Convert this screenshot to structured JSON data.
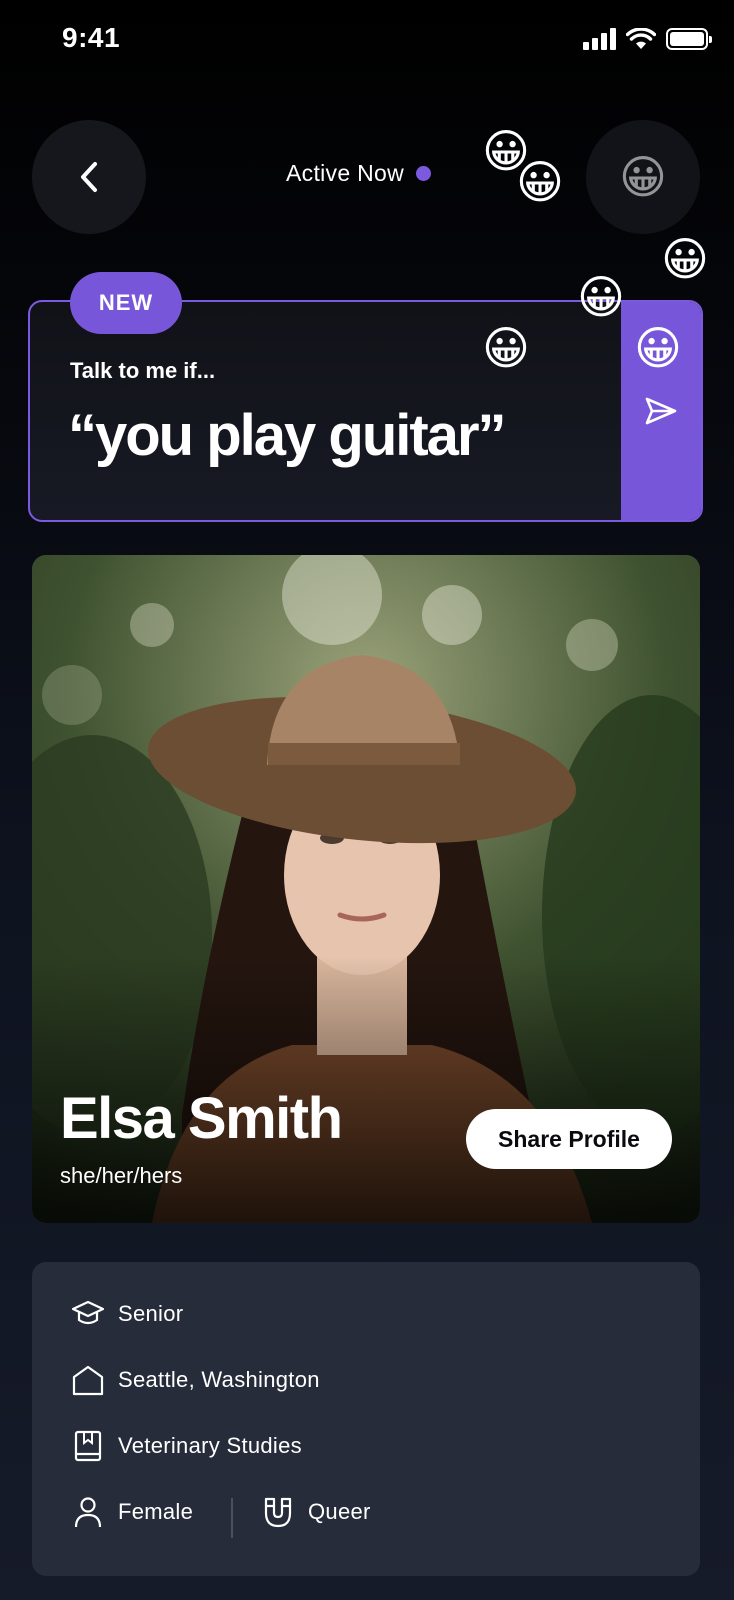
{
  "status_bar": {
    "time": "9:41"
  },
  "header": {
    "active_label": "Active Now"
  },
  "prompt": {
    "badge": "NEW",
    "label": "Talk to me if...",
    "text": "“you play guitar”"
  },
  "profile": {
    "name": "Elsa Smith",
    "pronouns": "she/her/hers",
    "share_label": "Share Profile"
  },
  "details": {
    "year": "Senior",
    "hometown": "Seattle, Washington",
    "major": "Veterinary Studies",
    "gender": "Female",
    "orientation": "Queer"
  },
  "reactions": {
    "emoji": "😀"
  },
  "colors": {
    "accent": "#7856d9",
    "card": "#272c3b"
  },
  "icons": [
    "chevron-left-icon",
    "send-icon",
    "graduation-cap-icon",
    "home-icon",
    "book-icon",
    "person-icon",
    "magnet-icon",
    "signal-icon",
    "wifi-icon",
    "battery-icon"
  ]
}
